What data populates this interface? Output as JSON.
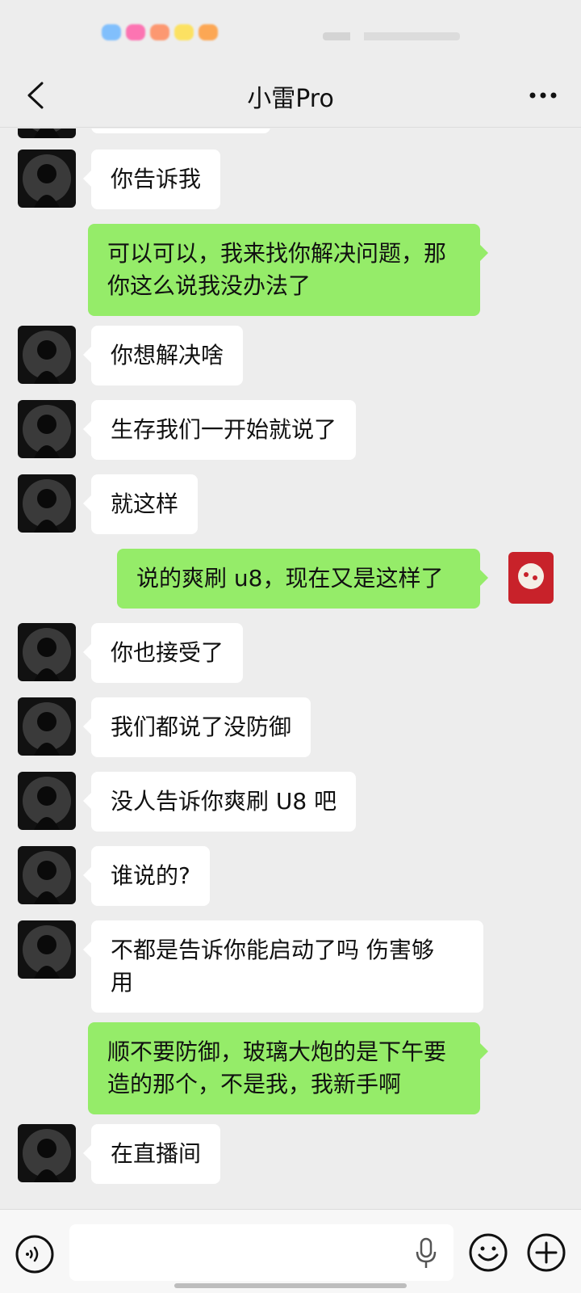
{
  "header": {
    "title": "小雷Pro"
  },
  "colors": {
    "background": "#ededed",
    "incoming_bubble": "#ffffff",
    "outgoing_bubble": "#95ec69",
    "input_bar": "#f7f7f7"
  },
  "messages": [
    {
      "side": "in",
      "text": "你告诉我"
    },
    {
      "side": "out",
      "lines": [
        "可以可以，我来找你解决问题，那",
        "你这么说我没办法了"
      ]
    },
    {
      "side": "in",
      "text": "你想解决啥"
    },
    {
      "side": "in",
      "text": "生存我们一开始就说了"
    },
    {
      "side": "in",
      "text": "就这样"
    },
    {
      "side": "out",
      "text": "说的爽刷 u8，现在又是这样了"
    },
    {
      "side": "in",
      "text": "你也接受了"
    },
    {
      "side": "in",
      "text": "我们都说了没防御"
    },
    {
      "side": "in",
      "text": "没人告诉你爽刷 U8 吧"
    },
    {
      "side": "in",
      "text": "谁说的?"
    },
    {
      "side": "in",
      "lines": [
        "不都是告诉你能启动了吗 伤害够",
        "用"
      ]
    },
    {
      "side": "out",
      "lines": [
        "顺不要防御，玻璃大炮的是下午要",
        "造的那个，不是我，我新手啊"
      ]
    },
    {
      "side": "in",
      "text": "在直播间"
    }
  ],
  "icons": {
    "back": "chevron-left-icon",
    "more": "more-dots-icon",
    "voice": "voice-input-icon",
    "mic": "microphone-icon",
    "emoji": "emoji-icon",
    "plus": "plus-icon"
  }
}
